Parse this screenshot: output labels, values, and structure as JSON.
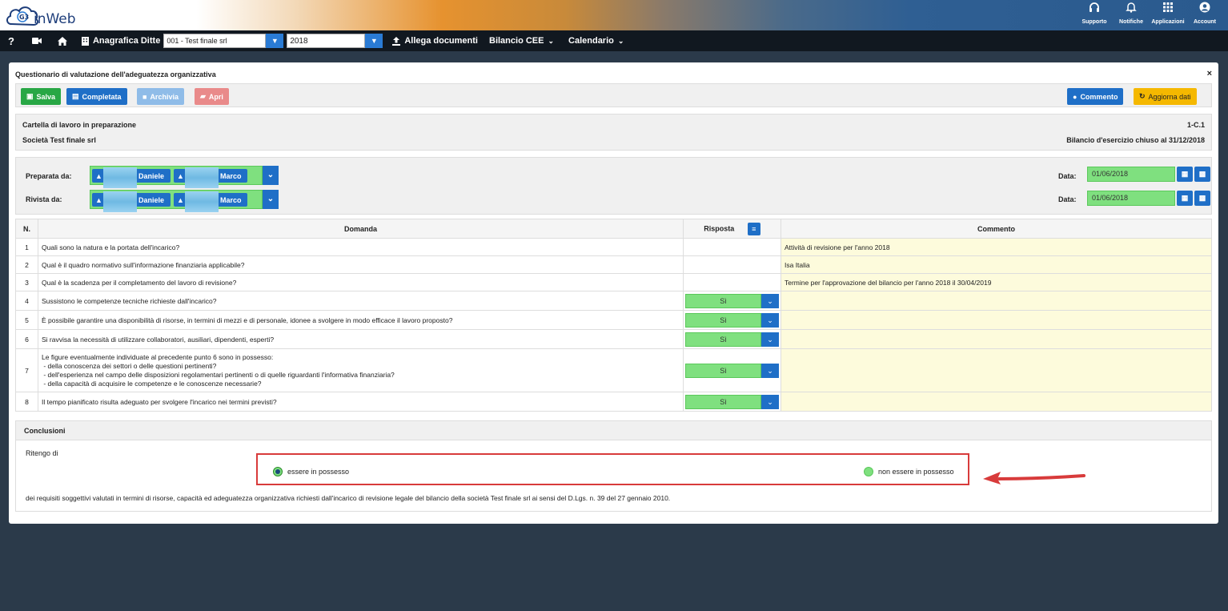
{
  "app": {
    "logo_text": "inWeb",
    "top_icons": [
      {
        "icon": "headset-icon",
        "label": "Supporto"
      },
      {
        "icon": "bell-icon",
        "label": "Notifiche"
      },
      {
        "icon": "grid-icon",
        "label": "Applicazioni"
      },
      {
        "icon": "user-icon",
        "label": "Account"
      }
    ]
  },
  "menubar": {
    "help": "?",
    "anagrafica_label": "Anagrafica Ditte",
    "company_select": "001 - Test finale srl",
    "year_select": "2018",
    "allega_label": "Allega documenti",
    "bilancio_label": "Bilancio CEE",
    "calendario_label": "Calendario"
  },
  "dialog": {
    "title": "Questionario di valutazione dell'adeguatezza organizzativa",
    "close": "×",
    "toolbar": {
      "salva": "Salva",
      "completata": "Completata",
      "archivia": "Archivia",
      "apri": "Apri",
      "commento": "Commento",
      "aggiorna": "Aggiorna dati"
    },
    "info": {
      "status": "Cartella di lavoro in preparazione",
      "code": "1-C.1",
      "company": "Società Test finale srl",
      "fiscal_year": "Bilancio d'esercizio chiuso al 31/12/2018"
    },
    "people": {
      "prepared_label": "Preparata da:",
      "reviewed_label": "Rivista da:",
      "person1": "Daniele",
      "person2": "Marco",
      "date_label": "Data:",
      "prepared_date": "01/06/2018",
      "reviewed_date": "01/06/2018"
    },
    "table": {
      "headers": {
        "n": "N.",
        "domanda": "Domanda",
        "risposta": "Risposta",
        "commento": "Commento"
      },
      "rows": [
        {
          "n": "1",
          "q": "Quali sono la natura e la portata dell'incarico?",
          "r": "",
          "c": "Attività di revisione per l'anno 2018"
        },
        {
          "n": "2",
          "q": "Qual è il quadro normativo sull'informazione finanziaria applicabile?",
          "r": "",
          "c": "Isa Italia"
        },
        {
          "n": "3",
          "q": "Qual è la scadenza per il completamento del lavoro di revisione?",
          "r": "",
          "c": "Termine per l'approvazione del bilancio per l'anno 2018 il 30/04/2019"
        },
        {
          "n": "4",
          "q": "Sussistono le competenze tecniche richieste dall'incarico?",
          "r": "Sì",
          "c": ""
        },
        {
          "n": "5",
          "q": "È possibile garantire una disponibilità di risorse, in termini di mezzi e di personale, idonee a svolgere in modo efficace il lavoro proposto?",
          "r": "Sì",
          "c": ""
        },
        {
          "n": "6",
          "q": "Si ravvisa la necessità di utilizzare collaboratori, ausiliari, dipendenti, esperti?",
          "r": "Sì",
          "c": ""
        },
        {
          "n": "7",
          "q_lines": [
            "Le figure eventualmente individuate al precedente punto 6 sono in possesso:",
            " - della conoscenza dei settori o delle questioni pertinenti?",
            " - dell'esperienza nel campo delle disposizioni regolamentari pertinenti o di quelle riguardanti l'informativa finanziaria?",
            " - della capacità di acquisire le competenze e le conoscenze necessarie?"
          ],
          "r": "Sì",
          "c": ""
        },
        {
          "n": "8",
          "q": "Il tempo pianificato risulta adeguato per svolgere l'incarico nei termini previsti?",
          "r": "Sì",
          "c": ""
        }
      ]
    },
    "conclusioni": {
      "header": "Conclusioni",
      "intro": "Ritengo di",
      "option1": "essere in possesso",
      "option2": "non essere in possesso",
      "footer": "dei requisiti soggettivi valutati in termini di risorse, capacità ed adeguatezza organizzativa richiesti dall'incarico di revisione legale del bilancio della società Test finale srl ai sensi del D.Lgs. n. 39 del 27 gennaio 2010."
    }
  },
  "colors": {
    "primary": "#1f6fc7",
    "success": "#28a745",
    "warning": "#f5b800",
    "danger_light": "#e98a8a",
    "info_light": "#8fbce8",
    "green_field": "#7fe07f",
    "comment_bg": "#fdfbdc",
    "highlight_red": "#d83b3b"
  }
}
